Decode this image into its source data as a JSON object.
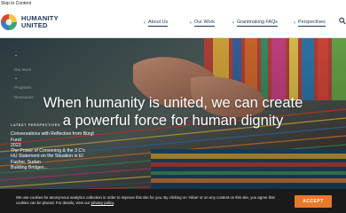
{
  "skip_link": "Skip to Content",
  "brand": {
    "line1": "HUMANITY",
    "line2": "UNITED"
  },
  "nav": {
    "items": [
      {
        "label": "About Us"
      },
      {
        "label": "Our Work"
      },
      {
        "label": "Grantmaking FAQs"
      },
      {
        "label": "Perspectives"
      }
    ],
    "search_icon": "search-icon"
  },
  "hero": {
    "title_line1": "When humanity is united, we can create",
    "title_line2": "a powerful force for human dignity",
    "side_faint": [
      "Our Work",
      "Programs",
      "Resources"
    ],
    "latest_label": "LATEST PERSPECTIVES",
    "latest_items": [
      "Conversations with Reflection from Bürgl Fund",
      "2023",
      "The Power of Convening & the 3 C's",
      "HU Statement on the Situation in El Fasher, Sudan",
      "Building Bridges..."
    ]
  },
  "cookie": {
    "text": "We use cookies for anonymous analytics collection in order to improve this site for you. By clicking on 'Allow' or on any content on this site, you agree that cookies can be placed. For details, view our",
    "link": "privacy policy",
    "end": ".",
    "accept_label": "ACCEPT"
  },
  "colors": {
    "brand_navy": "#1e3653",
    "accent_orange": "#e8792b",
    "cookie_bg": "#1a1a1a"
  }
}
